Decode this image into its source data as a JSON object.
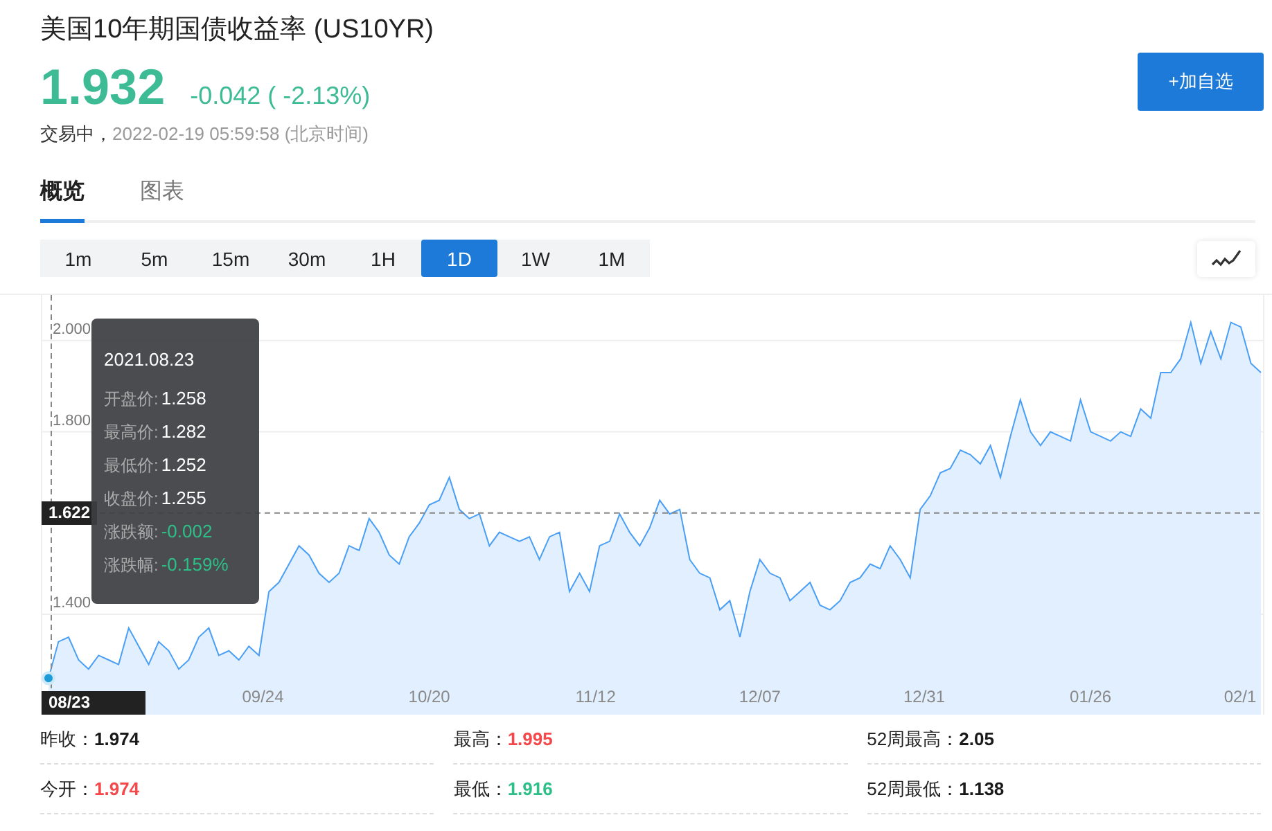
{
  "header": {
    "title": "美国10年期国债收益率 (US10YR)",
    "price": "1.932",
    "change": "-0.042 ( -2.13%)",
    "color": "#3dbb95",
    "status": "交易中，",
    "time": "2022-02-19 05:59:58 (北京时间)",
    "watch_button": "+加自选"
  },
  "tabs": [
    {
      "label": "概览",
      "selected": true
    },
    {
      "label": "图表",
      "selected": false
    }
  ],
  "periods": [
    {
      "label": "1m",
      "selected": false
    },
    {
      "label": "5m",
      "selected": false
    },
    {
      "label": "15m",
      "selected": false
    },
    {
      "label": "30m",
      "selected": false
    },
    {
      "label": "1H",
      "selected": false
    },
    {
      "label": "1D",
      "selected": true
    },
    {
      "label": "1W",
      "selected": false
    },
    {
      "label": "1M",
      "selected": false
    }
  ],
  "chart": {
    "chart_data": {
      "type": "area",
      "grid": true,
      "ref_lines": [
        {
          "axis": "y",
          "value": 1.622,
          "label": "1.622"
        }
      ],
      "ylim": [
        1.18,
        2.1
      ],
      "yticks": [
        {
          "value": 1.4,
          "label": "1.400"
        },
        {
          "value": 1.8,
          "label": "1.800"
        },
        {
          "value": 2.0,
          "label": "2.000"
        }
      ],
      "series": [
        {
          "color": "#4a9ff5",
          "values": [
            1.26,
            1.34,
            1.35,
            1.3,
            1.28,
            1.31,
            1.3,
            1.29,
            1.37,
            1.33,
            1.29,
            1.34,
            1.32,
            1.28,
            1.3,
            1.35,
            1.37,
            1.31,
            1.32,
            1.3,
            1.33,
            1.31,
            1.45,
            1.47,
            1.51,
            1.55,
            1.53,
            1.49,
            1.47,
            1.49,
            1.55,
            1.54,
            1.61,
            1.58,
            1.53,
            1.51,
            1.57,
            1.6,
            1.64,
            1.65,
            1.7,
            1.63,
            1.61,
            1.62,
            1.55,
            1.58,
            1.57,
            1.56,
            1.57,
            1.52,
            1.57,
            1.58,
            1.45,
            1.49,
            1.45,
            1.55,
            1.56,
            1.62,
            1.58,
            1.55,
            1.59,
            1.65,
            1.62,
            1.63,
            1.52,
            1.49,
            1.48,
            1.41,
            1.43,
            1.35,
            1.45,
            1.52,
            1.49,
            1.48,
            1.43,
            1.45,
            1.47,
            1.42,
            1.41,
            1.43,
            1.47,
            1.48,
            1.51,
            1.5,
            1.55,
            1.52,
            1.48,
            1.63,
            1.66,
            1.71,
            1.72,
            1.76,
            1.75,
            1.73,
            1.77,
            1.7,
            1.79,
            1.87,
            1.8,
            1.77,
            1.8,
            1.79,
            1.78,
            1.87,
            1.8,
            1.79,
            1.78,
            1.8,
            1.79,
            1.85,
            1.83,
            1.93,
            1.93,
            1.96,
            2.04,
            1.95,
            2.02,
            1.96,
            2.04,
            2.03,
            1.95,
            1.93
          ]
        }
      ]
    },
    "x_labels": [
      "09/24",
      "10/20",
      "11/12",
      "12/07",
      "12/31",
      "01/26",
      "02/1"
    ],
    "crosshair": {
      "x_label": "08/23"
    },
    "tooltip": {
      "date": "2021.08.23",
      "rows": [
        {
          "label": "开盘价:",
          "value": "1.258",
          "color": "#ffffff"
        },
        {
          "label": "最高价:",
          "value": "1.282",
          "color": "#ffffff"
        },
        {
          "label": "最低价:",
          "value": "1.252",
          "color": "#ffffff"
        },
        {
          "label": "收盘价:",
          "value": "1.255",
          "color": "#ffffff"
        },
        {
          "label": "涨跌额:",
          "value": "-0.002",
          "color": "#2dbf88"
        },
        {
          "label": "涨跌幅:",
          "value": "-0.159%",
          "color": "#2dbf88"
        }
      ]
    }
  },
  "stats": [
    {
      "label": "昨收：",
      "value": "1.974",
      "color": "#1a1a1a"
    },
    {
      "label": "最高：",
      "value": "1.995",
      "color": "#f5484b"
    },
    {
      "label": "52周最高：",
      "value": "2.05",
      "color": "#1a1a1a"
    },
    {
      "label": "今开：",
      "value": "1.974",
      "color": "#f5484b"
    },
    {
      "label": "最低：",
      "value": "1.916",
      "color": "#2dbf88"
    },
    {
      "label": "52周最低：",
      "value": "1.138",
      "color": "#1a1a1a"
    }
  ]
}
